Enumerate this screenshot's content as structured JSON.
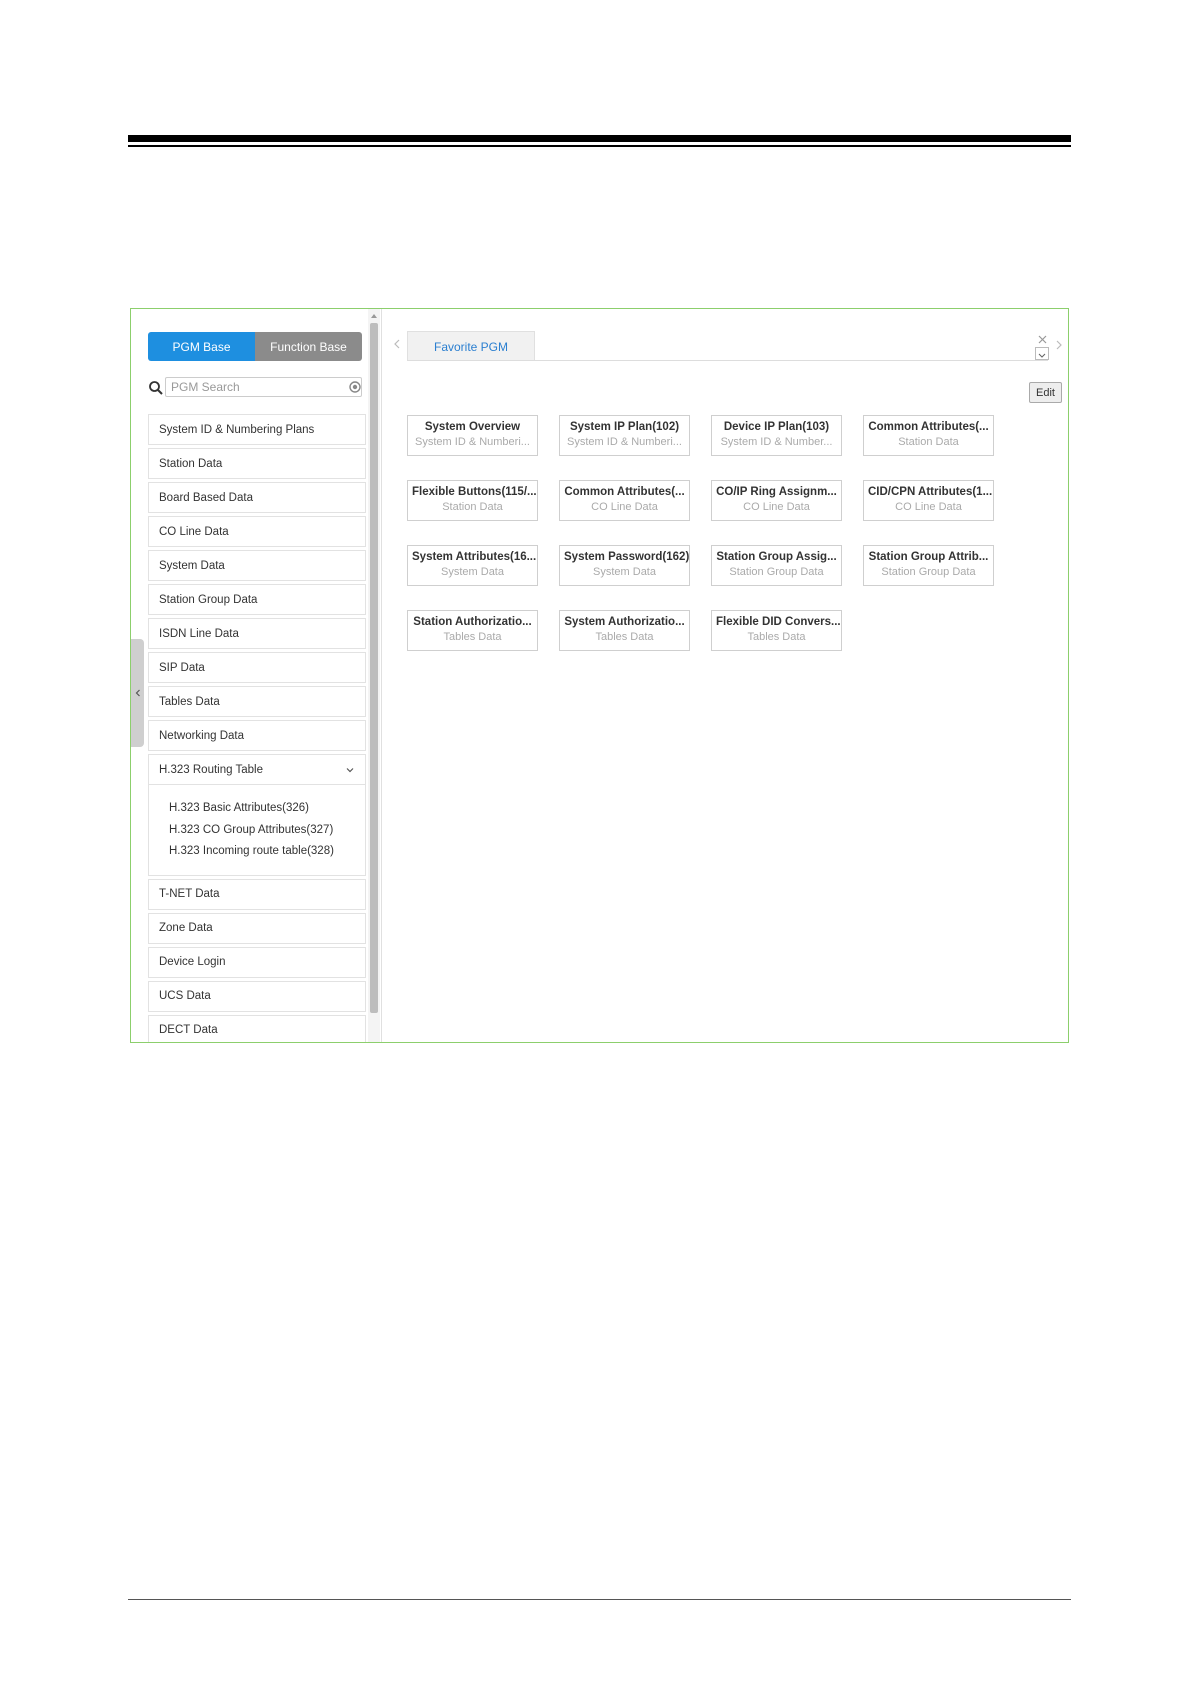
{
  "sidebar": {
    "toggle": {
      "active": "PGM Base",
      "inactive": "Function Base"
    },
    "search": {
      "placeholder": "PGM Search"
    },
    "items_top": [
      "System ID & Numbering Plans",
      "Station Data",
      "Board Based Data",
      "CO Line Data",
      "System Data",
      "Station Group Data",
      "ISDN Line Data",
      "SIP Data",
      "Tables Data",
      "Networking Data"
    ],
    "expanded": {
      "label": "H.323 Routing Table",
      "children": [
        "H.323 Basic Attributes(326)",
        "H.323 CO Group Attributes(327)",
        "H.323 Incoming route table(328)"
      ]
    },
    "items_bottom": [
      "T-NET Data",
      "Zone Data",
      "Device Login",
      "UCS Data",
      "DECT Data"
    ]
  },
  "main": {
    "tab": "Favorite PGM",
    "edit_label": "Edit",
    "tiles": [
      {
        "title": "System Overview",
        "sub": "System ID & Numberi..."
      },
      {
        "title": "System IP Plan(102)",
        "sub": "System ID & Numberi..."
      },
      {
        "title": "Device IP Plan(103)",
        "sub": "System ID & Number..."
      },
      {
        "title": "Common Attributes(...",
        "sub": "Station Data"
      },
      {
        "title": "Flexible Buttons(115/...",
        "sub": "Station Data"
      },
      {
        "title": "Common Attributes(...",
        "sub": "CO Line Data"
      },
      {
        "title": "CO/IP Ring Assignm...",
        "sub": "CO Line Data"
      },
      {
        "title": "CID/CPN Attributes(1...",
        "sub": "CO Line Data"
      },
      {
        "title": "System Attributes(16...",
        "sub": "System Data"
      },
      {
        "title": "System Password(162)",
        "sub": "System Data"
      },
      {
        "title": "Station Group Assig...",
        "sub": "Station Group Data"
      },
      {
        "title": "Station Group Attrib...",
        "sub": "Station Group Data"
      },
      {
        "title": "Station Authorizatio...",
        "sub": "Tables Data"
      },
      {
        "title": "System Authorizatio...",
        "sub": "Tables Data"
      },
      {
        "title": "Flexible DID Convers...",
        "sub": "Tables Data"
      }
    ]
  }
}
